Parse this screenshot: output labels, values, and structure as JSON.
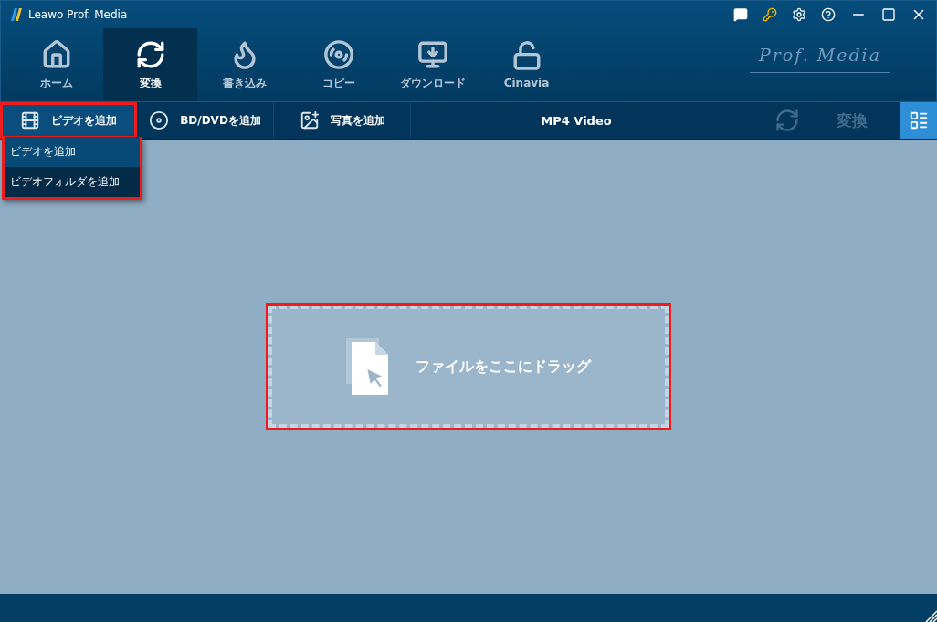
{
  "window": {
    "title": "Leawo Prof. Media"
  },
  "nav": [
    {
      "kind": "home",
      "label": "ホーム",
      "selected": false
    },
    {
      "kind": "convert",
      "label": "変換",
      "selected": true
    },
    {
      "kind": "burn",
      "label": "書き込み",
      "selected": false
    },
    {
      "kind": "copy",
      "label": "コピー",
      "selected": false
    },
    {
      "kind": "download",
      "label": "ダウンロード",
      "selected": false
    },
    {
      "kind": "cinavia",
      "label": "Cinavia",
      "selected": false
    }
  ],
  "logo": "Prof. Media",
  "toolbar": {
    "buttons": [
      {
        "kind": "video",
        "label": "ビデオを追加",
        "highlighted": true
      },
      {
        "kind": "disc",
        "label": "BD/DVDを追加",
        "highlighted": false
      },
      {
        "kind": "photo",
        "label": "写真を追加",
        "highlighted": false
      }
    ],
    "format": "MP4 Video",
    "convert": {
      "label": "変換",
      "disabled": true
    }
  },
  "dropdown": {
    "items": [
      {
        "label": "ビデオを追加",
        "selected": true
      },
      {
        "label": "ビデオフォルダを追加",
        "selected": false
      }
    ]
  },
  "drop_zone": {
    "text": "ファイルをここにドラッグ",
    "highlighted": true
  }
}
